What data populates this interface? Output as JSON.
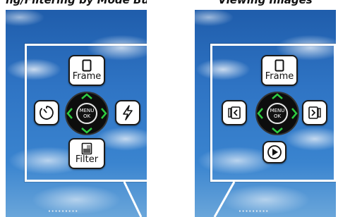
{
  "captions": {
    "left_partial": "ng/Filtering by Mode Button",
    "right_partial": "Viewing Images"
  },
  "left_panel": {
    "frame_button": {
      "label": "Frame",
      "icon": "frame-icon"
    },
    "filter_button": {
      "label": "Filter",
      "icon": "filter-icon"
    },
    "self_timer_button": {
      "icon": "self-timer-icon"
    },
    "flash_button": {
      "icon": "flash-icon"
    },
    "dial": {
      "center_line1": "MENU",
      "center_line2": "OK"
    }
  },
  "right_panel": {
    "frame_button": {
      "label": "Frame",
      "icon": "frame-icon"
    },
    "previous_button": {
      "icon": "previous-image-icon"
    },
    "next_button": {
      "icon": "next-image-icon"
    },
    "play_button": {
      "icon": "playback-icon"
    },
    "dial": {
      "center_line1": "MENU",
      "center_line2": "OK"
    }
  },
  "colors": {
    "dial_arrows": "#2ecc40",
    "sky": "#2f74c4",
    "frame_border": "#ffffff"
  },
  "dots_text": "·········"
}
